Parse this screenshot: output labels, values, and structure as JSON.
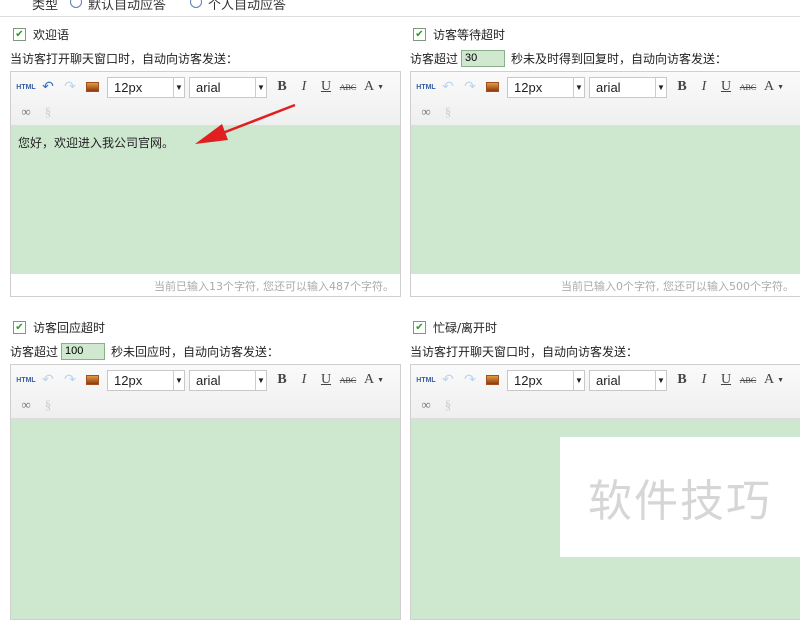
{
  "top": {
    "type_label": "类型",
    "radio1": "默认自动应答",
    "radio2": "个人自动应答"
  },
  "toolbar": {
    "html": "HTML",
    "font_size": "12px",
    "font_family": "arial",
    "bold": "B",
    "italic": "I",
    "underline": "U",
    "strike": "ABC",
    "color": "A"
  },
  "panels": [
    {
      "title": "欢迎语",
      "desc_before": "当访客打开聊天窗口时，自动向访客发送：",
      "seconds": null,
      "desc_after": "",
      "content": "您好，欢迎进入我公司官网。",
      "footer": "当前已输入13个字符, 您还可以输入487个字符。",
      "checked": true
    },
    {
      "title": "访客等待超时",
      "desc_before": "访客超过",
      "seconds": "30",
      "desc_after": "秒未及时得到回复时，自动向访客发送：",
      "content": "",
      "footer": "当前已输入0个字符, 您还可以输入500个字符。",
      "checked": true
    },
    {
      "title": "访客回应超时",
      "desc_before": "访客超过",
      "seconds": "100",
      "desc_after": "秒未回应时，自动向访客发送：",
      "content": "",
      "footer": "",
      "checked": true
    },
    {
      "title": "忙碌/离开时",
      "desc_before": "当访客打开聊天窗口时，自动向访客发送：",
      "seconds": null,
      "desc_after": "",
      "content": "",
      "footer": "",
      "checked": true
    }
  ],
  "watermark": "软件技巧",
  "colors": {
    "editor_bg": "#cee8d0",
    "arrow": "#e02020"
  }
}
